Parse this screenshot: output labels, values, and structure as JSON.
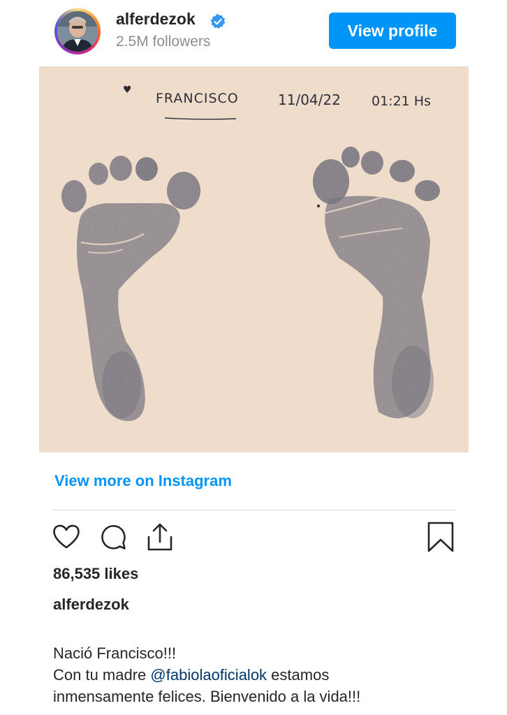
{
  "header": {
    "username": "alferdezok",
    "followers": "2.5M followers",
    "view_profile_label": "View profile"
  },
  "photo": {
    "note_name": "FRANCISCO",
    "note_date": "11/04/22",
    "note_time": "01:21 Hs"
  },
  "view_more_label": "View more on Instagram",
  "actions": {
    "icons": [
      "heart-icon",
      "comment-icon",
      "share-icon",
      "bookmark-icon"
    ]
  },
  "likes": "86,535 likes",
  "caption": {
    "username": "alferdezok",
    "line1": "Nació Francisco!!!",
    "line2_prefix": "Con tu madre ",
    "mention": "@fabiolaoficialok",
    "line2_suffix": " estamos",
    "line3": "inmensamente felices. Bienvenido a la vida!!!"
  },
  "colors": {
    "accent": "#0095f6",
    "verified": "#3897f0",
    "paper": "#efdccb",
    "ink": "#3c4157"
  }
}
